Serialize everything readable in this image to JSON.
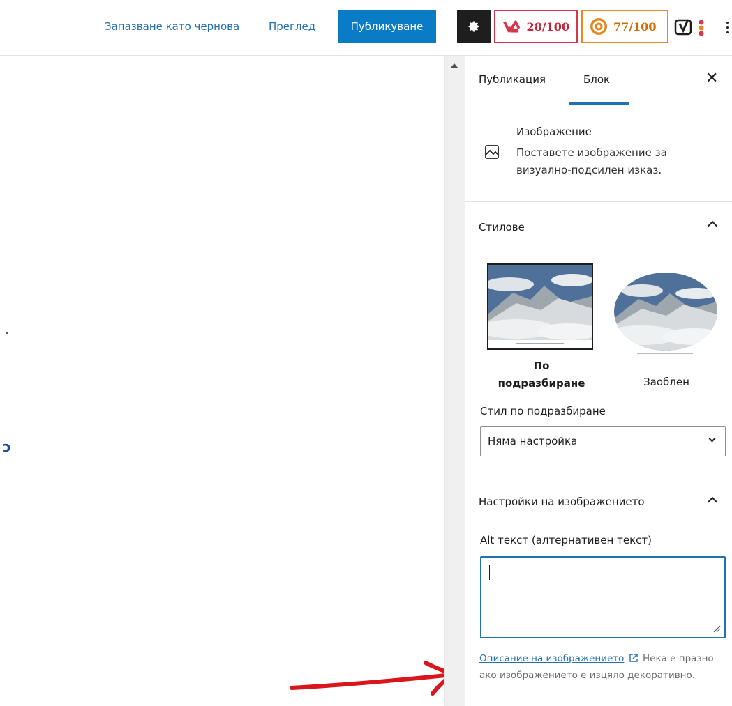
{
  "header": {
    "save_draft_label": "Запазване като чернова",
    "preview_label": "Преглед",
    "publish_label": "Публикуване",
    "seo_score": "28/100",
    "readability_score": "77/100",
    "colors": {
      "publish_bg": "#0a7cc6",
      "seo_red": "#d63649",
      "readability_orange": "#e6871f"
    }
  },
  "sidebar": {
    "tabs": [
      {
        "label": "Публикация"
      },
      {
        "label": "Блок"
      }
    ],
    "block_card": {
      "title": "Изображение",
      "description": "Поставете изображение за визуално-подсилен изказ."
    },
    "styles_panel": {
      "title": "Стилове",
      "style_default_label_line1": "По",
      "style_default_label_line2": "подразбиране",
      "style_rounded_label": "Заоблен",
      "default_style_label": "Стил по подразбиране",
      "default_style_value": "Няма настройка"
    },
    "image_settings_panel": {
      "title": "Настройки на изображението",
      "alt_label": "Alt текст (алтернативен текст)",
      "alt_value": "",
      "help_link": "Описание на изображението",
      "help_text": "Нека е празно ако изображението е изцяло декоративно."
    }
  },
  "canvas": {
    "fragment_text": "ɔ"
  }
}
